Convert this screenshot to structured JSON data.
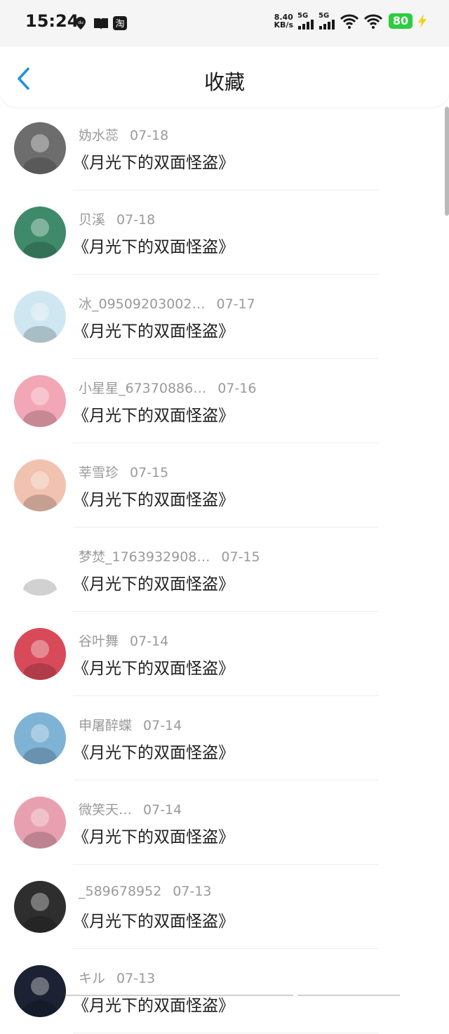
{
  "status_bar": {
    "time": "15:24",
    "net_speed_value": "8.40",
    "net_speed_unit": "KB/s",
    "signal_1_label": "5G",
    "signal_2_label": "5G",
    "battery": "80"
  },
  "header": {
    "title": "收藏"
  },
  "items": [
    {
      "name": "妫水蕊",
      "date": "07-18",
      "book": "《月光下的双面怪盗》",
      "avatar_color": "#6d6d6d"
    },
    {
      "name": "贝溪",
      "date": "07-18",
      "book": "《月光下的双面怪盗》",
      "avatar_color": "#3f8a6a"
    },
    {
      "name": "冰_09509203002…",
      "date": "07-17",
      "book": "《月光下的双面怪盗》",
      "avatar_color": "#cfe7f0"
    },
    {
      "name": "小星星_67370886…",
      "date": "07-16",
      "book": "《月光下的双面怪盗》",
      "avatar_color": "#f3a6b5"
    },
    {
      "name": "莘雪珍",
      "date": "07-15",
      "book": "《月光下的双面怪盗》",
      "avatar_color": "#f2c2b0"
    },
    {
      "name": "梦焚_1763932908…",
      "date": "07-15",
      "book": "《月光下的双面怪盗》",
      "avatar_color": "#ffffff"
    },
    {
      "name": "谷叶舞",
      "date": "07-14",
      "book": "《月光下的双面怪盗》",
      "avatar_color": "#d84a5a"
    },
    {
      "name": "申屠醉蝶",
      "date": "07-14",
      "book": "《月光下的双面怪盗》",
      "avatar_color": "#7fb3d6"
    },
    {
      "name": "微笑天…",
      "date": "07-14",
      "book": "《月光下的双面怪盗》",
      "avatar_color": "#e8a0b0"
    },
    {
      "name": "_589678952",
      "date": "07-13",
      "book": "《月光下的双面怪盗》",
      "avatar_color": "#2e2e2e"
    },
    {
      "name": "キル",
      "date": "07-13",
      "book": "《月光下的双面怪盗》",
      "avatar_color": "#1c2233"
    }
  ]
}
